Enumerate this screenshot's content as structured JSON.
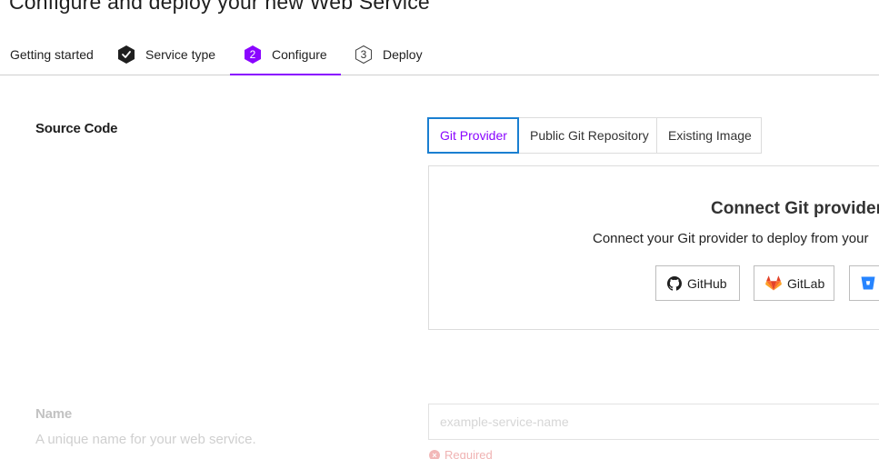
{
  "page": {
    "title": "Configure and deploy your new Web Service"
  },
  "stepper": {
    "steps": [
      {
        "label": "Getting started",
        "state": "done"
      },
      {
        "label": "Service type",
        "state": "complete",
        "icon": "check-hex-icon"
      },
      {
        "label": "Configure",
        "state": "active",
        "number": "2"
      },
      {
        "label": "Deploy",
        "state": "upcoming",
        "number": "3"
      }
    ]
  },
  "source_code": {
    "label": "Source Code",
    "tabs": [
      {
        "label": "Git Provider",
        "active": true
      },
      {
        "label": "Public Git Repository",
        "active": false
      },
      {
        "label": "Existing Image",
        "active": false
      }
    ],
    "panel": {
      "title": "Connect Git provider",
      "subtitle": "Connect your Git provider to deploy from your",
      "buttons": [
        {
          "label": "GitHub",
          "icon": "github-icon"
        },
        {
          "label": "GitLab",
          "icon": "gitlab-icon"
        },
        {
          "label": "",
          "icon": "bitbucket-icon"
        }
      ]
    }
  },
  "name_field": {
    "label": "Name",
    "help": "A unique name for your web service.",
    "placeholder": "example-service-name",
    "value": "",
    "error": "Required"
  },
  "colors": {
    "accent_purple": "#8a05ff",
    "focus_blue": "#1a7fd1",
    "gitlab_orange": "#e24329",
    "bitbucket_blue": "#2684ff"
  }
}
